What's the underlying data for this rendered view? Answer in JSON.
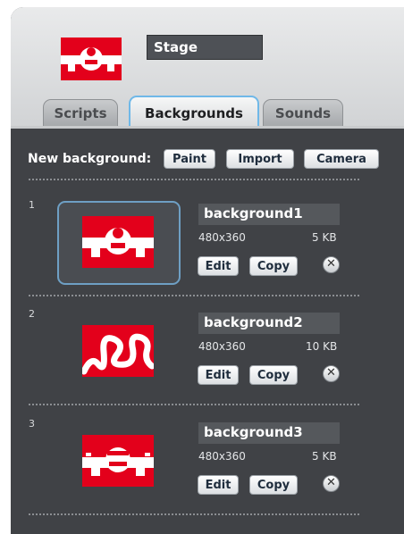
{
  "stage": {
    "name": "Stage",
    "thumbnail_icon": "stage-rover-icon"
  },
  "tabs": [
    {
      "label": "Scripts",
      "active": false
    },
    {
      "label": "Backgrounds",
      "active": true
    },
    {
      "label": "Sounds",
      "active": false
    }
  ],
  "new_background": {
    "label": "New background:",
    "buttons": [
      "Paint",
      "Import",
      "Camera"
    ]
  },
  "backgrounds": [
    {
      "index": "1",
      "name": "background1",
      "dimensions": "480x360",
      "size": "5 KB",
      "edit_label": "Edit",
      "copy_label": "Copy",
      "delete_glyph": "✕",
      "selected": true
    },
    {
      "index": "2",
      "name": "background2",
      "dimensions": "480x360",
      "size": "10 KB",
      "edit_label": "Edit",
      "copy_label": "Copy",
      "delete_glyph": "✕",
      "selected": false
    },
    {
      "index": "3",
      "name": "background3",
      "dimensions": "480x360",
      "size": "5 KB",
      "edit_label": "Edit",
      "copy_label": "Copy",
      "delete_glyph": "✕",
      "selected": false
    }
  ],
  "colors": {
    "thumbnail_red": "#e3001b",
    "panel_dark": "#404246",
    "selection_blue": "#6e9fc4"
  }
}
